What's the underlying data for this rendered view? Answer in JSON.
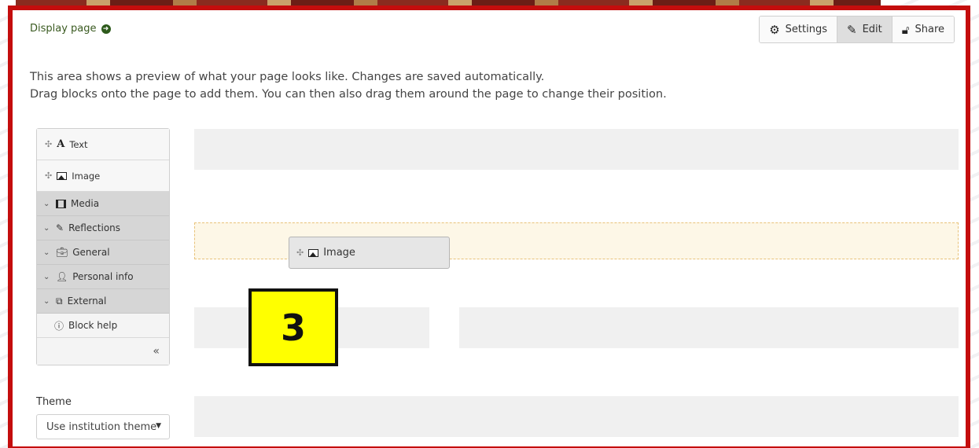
{
  "header": {
    "display_link": "Display page",
    "buttons": [
      {
        "label": "Settings",
        "icon": "gears-icon"
      },
      {
        "label": "Edit",
        "icon": "pencil-icon",
        "active": true
      },
      {
        "label": "Share",
        "icon": "unlock-icon"
      }
    ]
  },
  "intro": {
    "line1": "This area shows a preview of what your page looks like. Changes are saved automatically.",
    "line2": "Drag blocks onto the page to add them. You can then also drag them around the page to change their position."
  },
  "palette": {
    "items": [
      {
        "label": "Text",
        "icon": "text-A-icon"
      },
      {
        "label": "Image",
        "icon": "image-icon"
      }
    ],
    "categories": [
      {
        "label": "Media",
        "icon": "film-icon"
      },
      {
        "label": "Reflections",
        "icon": "pencil-icon"
      },
      {
        "label": "General",
        "icon": "briefcase-icon"
      },
      {
        "label": "Personal info",
        "icon": "user-icon"
      },
      {
        "label": "External",
        "icon": "external-link-icon"
      }
    ],
    "help": "Block help",
    "collapse": "«"
  },
  "theme": {
    "label": "Theme",
    "selected": "Use institution theme"
  },
  "drag_ghost": {
    "label": "Image"
  },
  "step_marker": "3",
  "colors": {
    "frame": "#c40d0d",
    "marker_bg": "#ffff00",
    "dropzone": "#fdf7e7"
  }
}
